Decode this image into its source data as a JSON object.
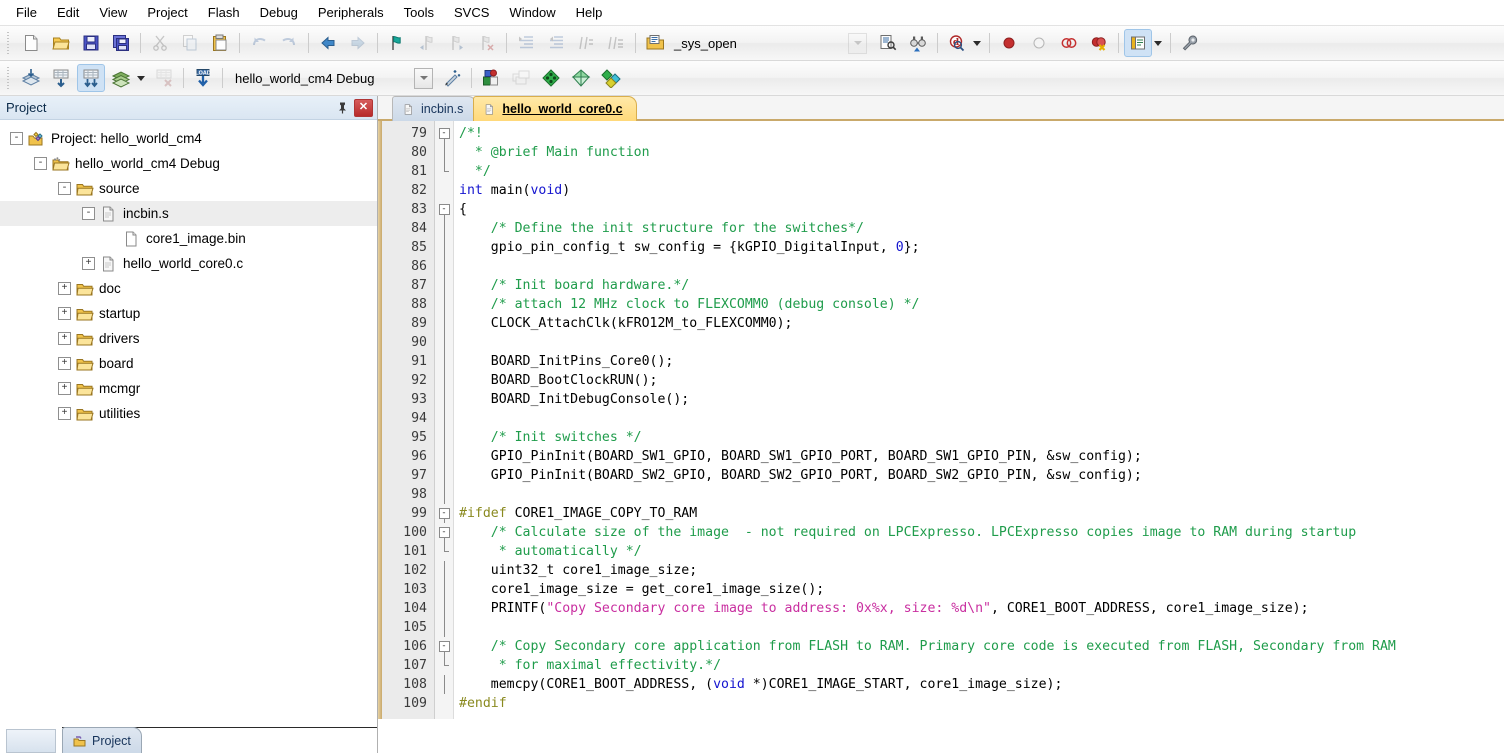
{
  "menu": {
    "items": [
      "File",
      "Edit",
      "View",
      "Project",
      "Flash",
      "Debug",
      "Peripherals",
      "Tools",
      "SVCS",
      "Window",
      "Help"
    ]
  },
  "toolbar_main": {
    "buttons": [
      {
        "name": "new-file",
        "icon": "new-document-icon",
        "enabled": true
      },
      {
        "name": "open-file",
        "icon": "open-folder-icon",
        "enabled": true
      },
      {
        "name": "save",
        "icon": "floppy-save-icon",
        "enabled": true
      },
      {
        "name": "save-all",
        "icon": "save-all-icon",
        "enabled": true
      },
      {
        "name": "cut",
        "icon": "scissors-icon",
        "enabled": false
      },
      {
        "name": "copy",
        "icon": "copy-icon",
        "enabled": false
      },
      {
        "name": "paste",
        "icon": "clipboard-paste-icon",
        "enabled": true
      },
      {
        "name": "undo",
        "icon": "undo-arrow-icon",
        "enabled": false
      },
      {
        "name": "redo",
        "icon": "redo-arrow-icon",
        "enabled": false
      },
      {
        "name": "navigate-back",
        "icon": "arrow-left-icon",
        "enabled": true
      },
      {
        "name": "navigate-forward",
        "icon": "arrow-right-icon",
        "enabled": false
      },
      {
        "name": "toggle-bookmark",
        "icon": "bookmark-flag-icon",
        "enabled": true
      },
      {
        "name": "previous-bookmark",
        "icon": "bookmark-prev-icon",
        "enabled": false
      },
      {
        "name": "next-bookmark",
        "icon": "bookmark-next-icon",
        "enabled": false
      },
      {
        "name": "clear-bookmarks",
        "icon": "bookmark-clear-icon",
        "enabled": false
      },
      {
        "name": "indent-right",
        "icon": "indent-right-icon",
        "enabled": false
      },
      {
        "name": "indent-left",
        "icon": "indent-left-icon",
        "enabled": false
      },
      {
        "name": "comment-block",
        "icon": "comment-lines-icon",
        "enabled": false
      },
      {
        "name": "uncomment-block",
        "icon": "uncomment-lines-icon",
        "enabled": false
      },
      {
        "name": "open-document",
        "icon": "open-document-icon",
        "enabled": true
      }
    ],
    "find_value": "_sys_open",
    "find_placeholder": "",
    "find_in_files_icon": "find-in-files-icon",
    "find_next_icon": "binoculars-icon",
    "browse_icon": "browse-search-icon",
    "breakpoint_icons": [
      {
        "name": "insert-remove-breakpoint",
        "icon": "breakpoint-red-dot-icon"
      },
      {
        "name": "enable-disable-breakpoint",
        "icon": "breakpoint-hollow-icon"
      },
      {
        "name": "disable-all-breakpoints",
        "icon": "breakpoints-disable-all-icon"
      },
      {
        "name": "kill-all-breakpoints",
        "icon": "breakpoints-kill-all-icon"
      }
    ],
    "window_button_icon": "manage-windows-icon",
    "configuration_icon": "wrench-configure-icon"
  },
  "toolbar_build": {
    "buttons": [
      {
        "name": "translate-file",
        "icon": "translate-file-icon",
        "enabled": true
      },
      {
        "name": "build-target",
        "icon": "build-target-icon",
        "enabled": true
      },
      {
        "name": "rebuild-all",
        "icon": "rebuild-all-icon",
        "enabled": true,
        "pressed": true
      },
      {
        "name": "batch-build",
        "icon": "batch-build-icon",
        "enabled": true
      },
      {
        "name": "stop-build",
        "icon": "stop-build-icon",
        "enabled": false
      },
      {
        "name": "download",
        "icon": "load-download-icon",
        "enabled": true
      }
    ],
    "target_value": "hello_world_cm4 Debug",
    "target_options": [
      "hello_world_cm4 Debug"
    ],
    "manage_wizard_icon": "magic-wand-icon",
    "right_buttons": [
      {
        "name": "manage-project-items",
        "icon": "project-components-icon"
      },
      {
        "name": "manage-multi-project",
        "icon": "multi-project-icon",
        "enabled": false
      },
      {
        "name": "pack-installer",
        "icon": "green-diamond-icon"
      },
      {
        "name": "manage-run-time-env",
        "icon": "rte-diamond-icon"
      },
      {
        "name": "select-software-packs",
        "icon": "software-packs-icon"
      }
    ]
  },
  "project_panel": {
    "title": "Project",
    "pin_icon": "pushpin-icon",
    "close_icon": "close-x-icon",
    "tree": [
      {
        "label": "Project: hello_world_cm4",
        "depth": 0,
        "expander": "-",
        "icon": "project-icon",
        "selected": false,
        "annotated": false
      },
      {
        "label": "hello_world_cm4 Debug",
        "depth": 1,
        "expander": "-",
        "icon": "target-folder-icon",
        "selected": false,
        "annotated": false
      },
      {
        "label": "source",
        "depth": 2,
        "expander": "-",
        "icon": "group-folder-icon",
        "selected": false,
        "annotated": false
      },
      {
        "label": "incbin.s",
        "depth": 3,
        "expander": "-",
        "icon": "file-icon",
        "selected": true,
        "annotated": false
      },
      {
        "label": "core1_image.bin",
        "depth": 4,
        "expander": "",
        "icon": "file-plain-icon",
        "selected": false,
        "annotated": true
      },
      {
        "label": "hello_world_core0.c",
        "depth": 3,
        "expander": "+",
        "icon": "file-icon",
        "selected": false,
        "annotated": false
      },
      {
        "label": "doc",
        "depth": 2,
        "expander": "+",
        "icon": "group-folder-icon",
        "selected": false,
        "annotated": false
      },
      {
        "label": "startup",
        "depth": 2,
        "expander": "+",
        "icon": "group-folder-icon",
        "selected": false,
        "annotated": false
      },
      {
        "label": "drivers",
        "depth": 2,
        "expander": "+",
        "icon": "group-folder-icon",
        "selected": false,
        "annotated": false
      },
      {
        "label": "board",
        "depth": 2,
        "expander": "+",
        "icon": "group-folder-icon",
        "selected": false,
        "annotated": false
      },
      {
        "label": "mcmgr",
        "depth": 2,
        "expander": "+",
        "icon": "group-folder-icon",
        "selected": false,
        "annotated": false
      },
      {
        "label": "utilities",
        "depth": 2,
        "expander": "+",
        "icon": "group-folder-icon",
        "selected": false,
        "annotated": false
      }
    ],
    "bottom_tabs": [
      "Project"
    ]
  },
  "editor": {
    "tabs": [
      {
        "label": "incbin.s",
        "active": false,
        "icon": "file-icon"
      },
      {
        "label": "hello_world_core0.c",
        "active": true,
        "icon": "file-icon"
      }
    ],
    "first_line_number": 79,
    "lines": [
      {
        "n": 79,
        "fold": "open",
        "tokens": [
          {
            "t": "/*!",
            "c": "cm"
          }
        ]
      },
      {
        "n": 80,
        "fold": "bar",
        "tokens": [
          {
            "t": "  * @brief Main function",
            "c": "cm"
          }
        ]
      },
      {
        "n": 81,
        "fold": "end",
        "tokens": [
          {
            "t": "  */",
            "c": "cm"
          }
        ]
      },
      {
        "n": 82,
        "fold": "",
        "tokens": [
          {
            "t": "int ",
            "c": "k"
          },
          {
            "t": "main(",
            "c": "nm"
          },
          {
            "t": "void",
            "c": "k"
          },
          {
            "t": ")",
            "c": "nm"
          }
        ]
      },
      {
        "n": 83,
        "fold": "open",
        "tokens": [
          {
            "t": "{",
            "c": "nm"
          }
        ]
      },
      {
        "n": 84,
        "fold": "bar",
        "tokens": [
          {
            "t": "    /* Define the init structure for the switches*/",
            "c": "cm"
          }
        ]
      },
      {
        "n": 85,
        "fold": "bar",
        "tokens": [
          {
            "t": "    gpio_pin_config_t sw_config = {kGPIO_DigitalInput, ",
            "c": "nm"
          },
          {
            "t": "0",
            "c": "k"
          },
          {
            "t": "};",
            "c": "nm"
          }
        ]
      },
      {
        "n": 86,
        "fold": "bar",
        "tokens": [
          {
            "t": "",
            "c": "nm"
          }
        ]
      },
      {
        "n": 87,
        "fold": "bar",
        "tokens": [
          {
            "t": "    /* Init board hardware.*/",
            "c": "cm"
          }
        ]
      },
      {
        "n": 88,
        "fold": "bar",
        "tokens": [
          {
            "t": "    /* attach 12 MHz clock to FLEXCOMM0 (debug console) */",
            "c": "cm"
          }
        ]
      },
      {
        "n": 89,
        "fold": "bar",
        "tokens": [
          {
            "t": "    CLOCK_AttachClk(kFRO12M_to_FLEXCOMM0);",
            "c": "nm"
          }
        ]
      },
      {
        "n": 90,
        "fold": "bar",
        "tokens": [
          {
            "t": "",
            "c": "nm"
          }
        ]
      },
      {
        "n": 91,
        "fold": "bar",
        "tokens": [
          {
            "t": "    BOARD_InitPins_Core0();",
            "c": "nm"
          }
        ]
      },
      {
        "n": 92,
        "fold": "bar",
        "tokens": [
          {
            "t": "    BOARD_BootClockRUN();",
            "c": "nm"
          }
        ]
      },
      {
        "n": 93,
        "fold": "bar",
        "tokens": [
          {
            "t": "    BOARD_InitDebugConsole();",
            "c": "nm"
          }
        ]
      },
      {
        "n": 94,
        "fold": "bar",
        "tokens": [
          {
            "t": "",
            "c": "nm"
          }
        ]
      },
      {
        "n": 95,
        "fold": "bar",
        "tokens": [
          {
            "t": "    /* Init switches */",
            "c": "cm"
          }
        ]
      },
      {
        "n": 96,
        "fold": "bar",
        "tokens": [
          {
            "t": "    GPIO_PinInit(BOARD_SW1_GPIO, BOARD_SW1_GPIO_PORT, BOARD_SW1_GPIO_PIN, &sw_config);",
            "c": "nm"
          }
        ]
      },
      {
        "n": 97,
        "fold": "bar",
        "tokens": [
          {
            "t": "    GPIO_PinInit(BOARD_SW2_GPIO, BOARD_SW2_GPIO_PORT, BOARD_SW2_GPIO_PIN, &sw_config);",
            "c": "nm"
          }
        ]
      },
      {
        "n": 98,
        "fold": "bar",
        "tokens": [
          {
            "t": "",
            "c": "nm"
          }
        ]
      },
      {
        "n": 99,
        "fold": "open",
        "tokens": [
          {
            "t": "#ifdef",
            "c": "pp"
          },
          {
            "t": " CORE1_IMAGE_COPY_TO_RAM",
            "c": "nm"
          }
        ]
      },
      {
        "n": 100,
        "fold": "open",
        "tokens": [
          {
            "t": "    /* Calculate size of the image  - not required on LPCExpresso. LPCExpresso copies image to RAM during startup",
            "c": "cm"
          }
        ]
      },
      {
        "n": 101,
        "fold": "end",
        "tokens": [
          {
            "t": "     * automatically */",
            "c": "cm"
          }
        ]
      },
      {
        "n": 102,
        "fold": "bar",
        "tokens": [
          {
            "t": "    uint32_t core1_image_size;",
            "c": "nm"
          }
        ]
      },
      {
        "n": 103,
        "fold": "bar",
        "tokens": [
          {
            "t": "    core1_image_size = get_core1_image_size();",
            "c": "nm"
          }
        ]
      },
      {
        "n": 104,
        "fold": "bar",
        "tokens": [
          {
            "t": "    PRINTF(",
            "c": "nm"
          },
          {
            "t": "\"Copy Secondary core image to address: 0x%x, size: %d\\n\"",
            "c": "st"
          },
          {
            "t": ", CORE1_BOOT_ADDRESS, core1_image_size);",
            "c": "nm"
          }
        ]
      },
      {
        "n": 105,
        "fold": "bar",
        "tokens": [
          {
            "t": "",
            "c": "nm"
          }
        ]
      },
      {
        "n": 106,
        "fold": "open",
        "tokens": [
          {
            "t": "    /* Copy Secondary core application from FLASH to RAM. Primary core code is executed from FLASH, Secondary from RAM",
            "c": "cm"
          }
        ]
      },
      {
        "n": 107,
        "fold": "end",
        "tokens": [
          {
            "t": "     * for maximal effectivity.*/",
            "c": "cm"
          }
        ]
      },
      {
        "n": 108,
        "fold": "bar",
        "tokens": [
          {
            "t": "    memcpy(CORE1_BOOT_ADDRESS, (",
            "c": "nm"
          },
          {
            "t": "void",
            "c": "k"
          },
          {
            "t": " *)CORE1_IMAGE_START, core1_image_size);",
            "c": "nm"
          }
        ]
      },
      {
        "n": 109,
        "fold": "",
        "tokens": [
          {
            "t": "#endif",
            "c": "pp"
          }
        ]
      }
    ]
  },
  "colors": {
    "comment": "#1f9c4b",
    "keyword": "#1414cf",
    "string": "#c92fa0",
    "preprocessor": "#8a8a20",
    "active_tab": "#ffd97a",
    "inactive_tab": "#ccd9e8",
    "annotation_underline": "#2b2fa8",
    "panel_header": "#dae6f2"
  }
}
